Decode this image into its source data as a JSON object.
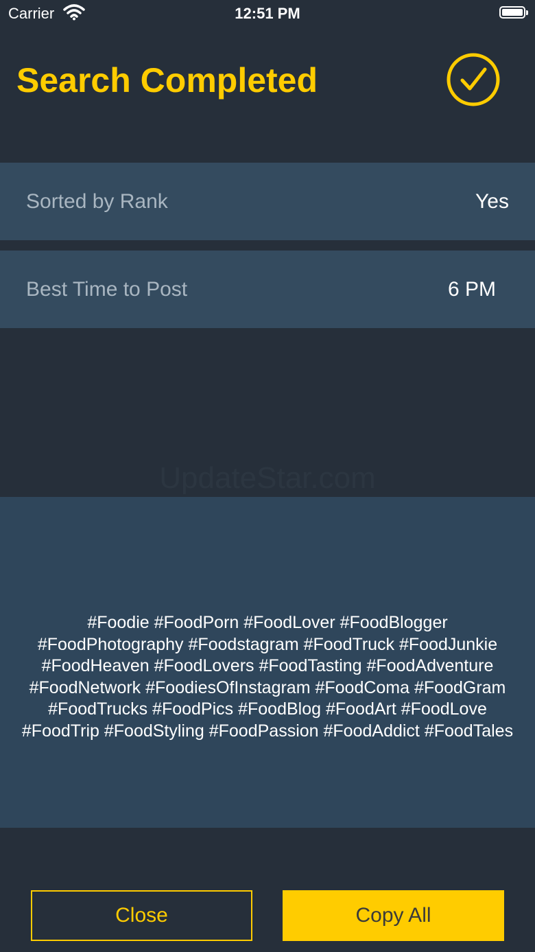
{
  "status_bar": {
    "carrier": "Carrier",
    "time": "12:51 PM"
  },
  "header": {
    "title": "Search Completed",
    "icon": "check-circle-icon"
  },
  "rows": [
    {
      "label": "Sorted by Rank",
      "value": "Yes"
    },
    {
      "label": "Best Time to Post",
      "value": "6 PM"
    }
  ],
  "watermark": "UpdateStar.com",
  "hashtags": "#Foodie #FoodPorn #FoodLover #FoodBlogger #FoodPhotography #Foodstagram #FoodTruck #FoodJunkie #FoodHeaven #FoodLovers #FoodTasting #FoodAdventure #FoodNetwork #FoodiesOfInstagram #FoodComa #FoodGram #FoodTrucks #FoodPics #FoodBlog #FoodArt #FoodLove #FoodTrip #FoodStyling #FoodPassion #FoodAddict #FoodTales",
  "buttons": {
    "close": "Close",
    "copy_all": "Copy All"
  },
  "colors": {
    "background": "#262f3a",
    "row": "#344b5f",
    "panel": "#2f465b",
    "accent": "#ffcc00"
  }
}
